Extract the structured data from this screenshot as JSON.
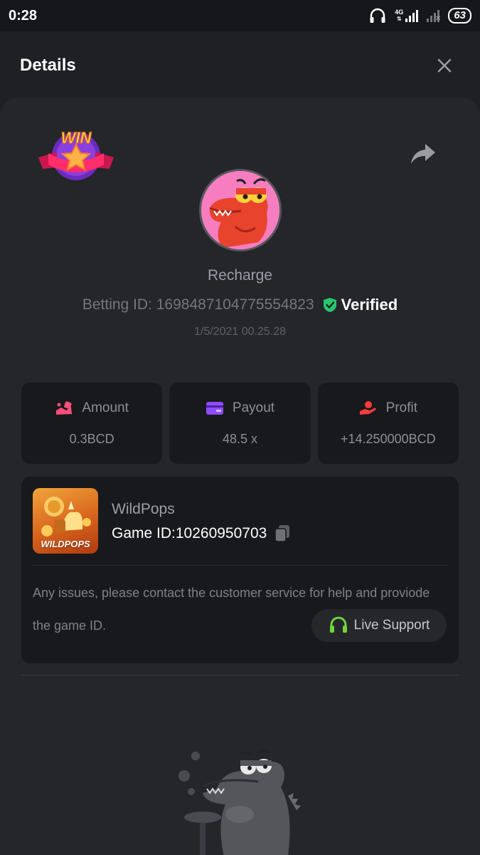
{
  "status_bar": {
    "time": "0:28",
    "network_label": "4G",
    "battery": "63"
  },
  "header": {
    "title": "Details"
  },
  "bet": {
    "badge": "WIN",
    "user_name": "Recharge",
    "betting_id_label": "Betting ID:",
    "betting_id": "1698487104775554823",
    "verified_label": "Verified",
    "date": "1/5/2021 00.25.28"
  },
  "stats": [
    {
      "label": "Amount",
      "value": "0.3BCD",
      "icon": "amount-icon",
      "color": "#ff4e7a"
    },
    {
      "label": "Payout",
      "value": "48.5 x",
      "icon": "payout-card-icon",
      "color": "#8e4dff"
    },
    {
      "label": "Profit",
      "value": "+14.250000BCD",
      "icon": "profit-hand-icon",
      "color": "#ff3b3b"
    }
  ],
  "game": {
    "thumbnail_label": "WILDPOPS",
    "name": "WildPops",
    "id_label": "Game ID:",
    "id": "10260950703",
    "help_text": "Any issues, please contact the customer service for help and proviode the game ID.",
    "live_support_label": "Live Support"
  },
  "colors": {
    "background": "#1f2023",
    "card": "#25262a",
    "panel": "#18191c",
    "verified_green": "#28c76f",
    "support_green": "#6fd63a"
  }
}
